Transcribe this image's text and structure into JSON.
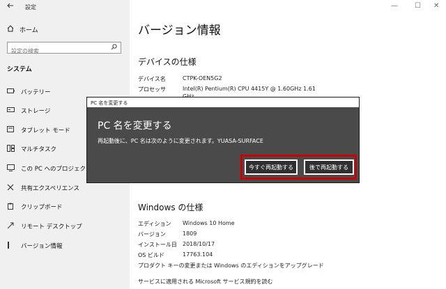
{
  "window": {
    "title": "設定"
  },
  "window_controls": {
    "minimize": "—",
    "maximize": "☐",
    "close": "✕"
  },
  "sidebar": {
    "back_icon": "arrow-left-icon",
    "home": {
      "icon": "home-icon",
      "label": "ホーム"
    },
    "search_placeholder": "設定の検索",
    "search_icon": "search-icon",
    "section_label": "システム",
    "items": [
      {
        "icon": "battery-icon",
        "label": "バッテリー"
      },
      {
        "icon": "storage-icon",
        "label": "ストレージ"
      },
      {
        "icon": "tablet-mode-icon",
        "label": "タブレット モード"
      },
      {
        "icon": "multitask-icon",
        "label": "マルチタスク"
      },
      {
        "icon": "projection-icon",
        "label": "この PC へのプロジェクション"
      },
      {
        "icon": "shared-experiences-icon",
        "label": "共有エクスペリエンス"
      },
      {
        "icon": "clipboard-icon",
        "label": "クリップボード"
      },
      {
        "icon": "remote-desktop-icon",
        "label": "リモート デスクトップ"
      },
      {
        "icon": "info-icon",
        "label": "バージョン情報"
      }
    ]
  },
  "main": {
    "title": "バージョン情報",
    "device_spec": {
      "heading": "デバイスの仕様",
      "rows": [
        {
          "key": "デバイス名",
          "value": "CTPK-OEN5G2"
        },
        {
          "key": "プロセッサ",
          "value": "Intel(R) Pentium(R) CPU 4415Y @ 1.60GHz   1.61"
        }
      ],
      "overflow_text": "GHz"
    },
    "windows_spec": {
      "heading": "Windows の仕様",
      "rows": [
        {
          "key": "エディション",
          "value": "Windows 10 Home"
        },
        {
          "key": "バージョン",
          "value": "1809"
        },
        {
          "key": "インストール日",
          "value": "2018/10/17"
        },
        {
          "key": "OS ビルド",
          "value": "17763.104"
        }
      ]
    },
    "change_key_link": "プロダクト キーの変更または Windows のエディションをアップグレード",
    "ms_terms_link": "サービスに適用される Microsoft サービス規約を読む"
  },
  "dialog": {
    "titlebar": "PC 名を変更する",
    "title": "PC 名を変更する",
    "message": "再起動後に、PC 名は次のように変更されます。YUASA-SURFACE",
    "restart_now": "今すぐ再起動する",
    "restart_later": "後で再起動する",
    "highlight_color": "#cc0000"
  }
}
